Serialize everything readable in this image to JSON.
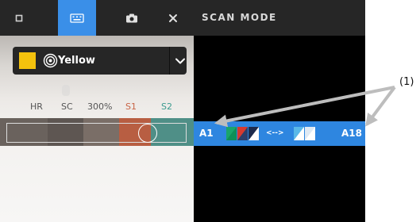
{
  "toolbar": {
    "mode_title": "SCAN MODE",
    "buttons": [
      {
        "name": "square-icon",
        "active": false
      },
      {
        "name": "keyboard-icon",
        "active": true
      },
      {
        "name": "camera-icon",
        "active": false
      },
      {
        "name": "close-icon",
        "active": false
      }
    ]
  },
  "color_selector": {
    "value": "Yellow",
    "swatch_color": "#F4C20D",
    "icon": "target-icon",
    "chevron": "chevron-down-icon"
  },
  "scale": {
    "labels": [
      "HR",
      "SC",
      "300%",
      "S1",
      "S2"
    ],
    "label_colors": [
      "#555555",
      "#555555",
      "#555555",
      "#C86446",
      "#3A9A8E"
    ]
  },
  "scan_bar": {
    "start_label": "A1",
    "end_label": "A18",
    "range_symbol": "<-->",
    "color": "#2E86E0"
  },
  "annotation": {
    "label": "(1)"
  }
}
